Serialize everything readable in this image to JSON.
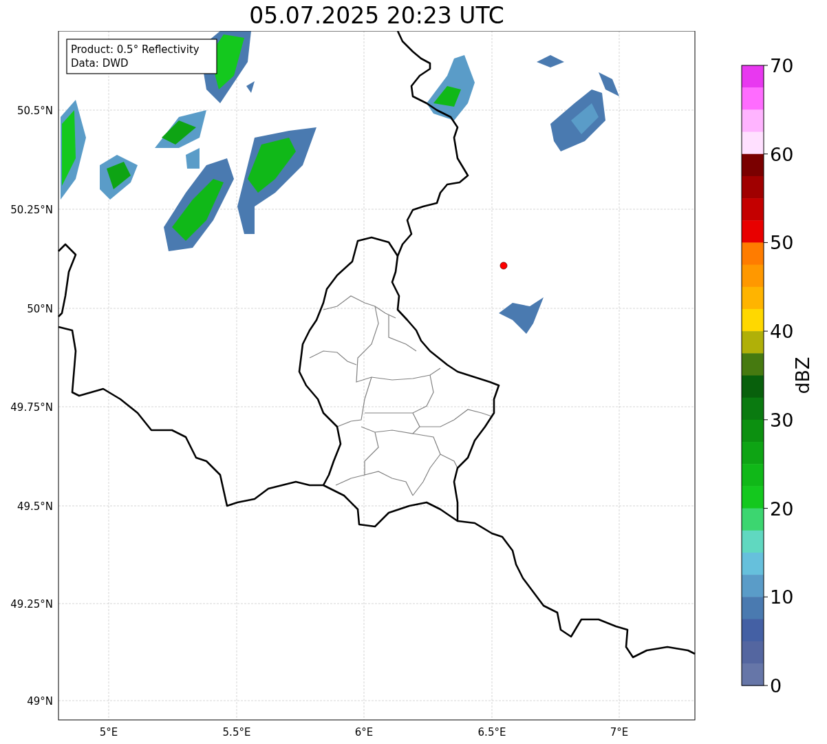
{
  "title": "05.07.2025 20:23 UTC",
  "info_box": [
    "Product: 0.5° Reflectivity",
    "Data: DWD"
  ],
  "map": {
    "x_ticks": [
      "5°E",
      "5.5°E",
      "6°E",
      "6.5°E",
      "7°E"
    ],
    "y_ticks": [
      "50.5°N",
      "50.25°N",
      "50°N",
      "49.75°N",
      "49.5°N",
      "49.25°N",
      "49°N"
    ]
  },
  "colorbar": {
    "label": "dBZ",
    "ticks": [
      "70",
      "60",
      "50",
      "40",
      "30",
      "20",
      "10",
      "0"
    ],
    "segments": [
      {
        "color": "#e838f0"
      },
      {
        "color": "#ff6cff"
      },
      {
        "color": "#ffb4ff"
      },
      {
        "color": "#ffe0ff"
      },
      {
        "color": "#7a0000"
      },
      {
        "color": "#a00000"
      },
      {
        "color": "#c40000"
      },
      {
        "color": "#e80000"
      },
      {
        "color": "#ff7c00"
      },
      {
        "color": "#ff9800"
      },
      {
        "color": "#ffb400"
      },
      {
        "color": "#ffd800"
      },
      {
        "color": "#b0b008"
      },
      {
        "color": "#467a10"
      },
      {
        "color": "#08600c"
      },
      {
        "color": "#0a7a10"
      },
      {
        "color": "#0c9010"
      },
      {
        "color": "#0ea414"
      },
      {
        "color": "#10b818"
      },
      {
        "color": "#14c81e"
      },
      {
        "color": "#3cd670"
      },
      {
        "color": "#60d8c0"
      },
      {
        "color": "#66c0dc"
      },
      {
        "color": "#5a9cc8"
      },
      {
        "color": "#4a7ab0"
      },
      {
        "color": "#4460a4"
      },
      {
        "color": "#5466a0"
      },
      {
        "color": "#6676a8"
      }
    ]
  }
}
